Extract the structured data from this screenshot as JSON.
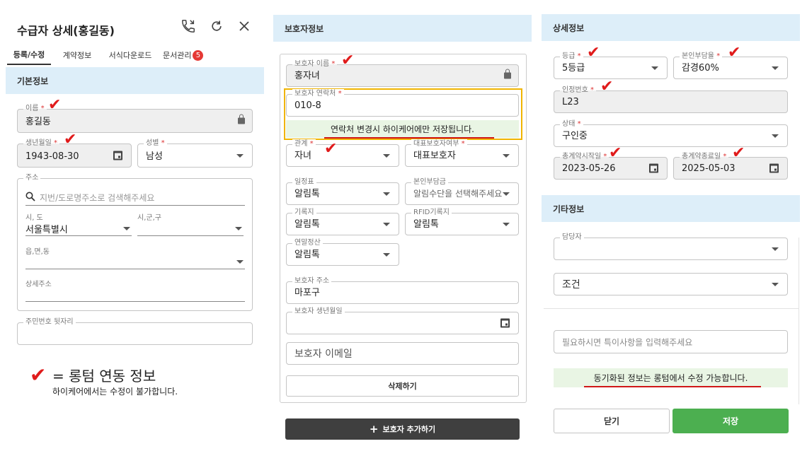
{
  "left": {
    "title": "수급자 상세(홍길동)",
    "tabs": [
      "등록/수정",
      "계약정보",
      "서식다운로드",
      "문서관리"
    ],
    "doc_badge": "5",
    "section": "기본정보",
    "name": {
      "label": "이름",
      "value": "홍길동"
    },
    "birth": {
      "label": "생년월일",
      "value": "1943-08-30"
    },
    "gender": {
      "label": "성별",
      "value": "남성"
    },
    "address": {
      "label": "주소",
      "search_placeholder": "지번/도로명주소로 검색해주세요",
      "sido_label": "시, 도",
      "sido_value": "서울특별시",
      "sigungu_label": "시,군,구",
      "dong_label": "읍,면,동",
      "detail_label": "상세주소"
    },
    "rrn": {
      "label": "주민번호 뒷자리"
    },
    "legend_title": "= 롱텀 연동 정보",
    "legend_sub": "하이케어에서는 수정이 불가합니다."
  },
  "middle": {
    "section": "보호자정보",
    "guardian_name": {
      "label": "보호자 이름",
      "value": "홍자녀"
    },
    "guardian_phone": {
      "label": "보호자 연락처",
      "value": "010-8"
    },
    "phone_notice": "연락처 변경시 하이케어에만 저장됩니다.",
    "relation": {
      "label": "관계",
      "value": "자녀"
    },
    "primary": {
      "label": "대표보호자여부",
      "value": "대표보호자"
    },
    "schedule": {
      "label": "일정표",
      "value": "알림톡"
    },
    "copay": {
      "label": "본인부담금",
      "value": "알림수단을 선택해주세요"
    },
    "record": {
      "label": "기록지",
      "value": "알림톡"
    },
    "rfid": {
      "label": "RFID기록지",
      "value": "알림톡"
    },
    "yearend": {
      "label": "연말정산",
      "value": "알림톡"
    },
    "guardian_addr": {
      "label": "보호자 주소",
      "value": "마포구"
    },
    "guardian_birth": {
      "label": "보호자 생년월일"
    },
    "guardian_email": {
      "placeholder": "보호자 이메일"
    },
    "delete_label": "삭제하기",
    "add_label": "보호자 추가하기"
  },
  "right": {
    "section": "상세정보",
    "grade": {
      "label": "등급",
      "value": "5등급"
    },
    "copay_rate": {
      "label": "본인부담율",
      "value": "감경60%"
    },
    "cert_no": {
      "label": "인정번호",
      "value": "L23"
    },
    "status": {
      "label": "상태",
      "value": "구인중"
    },
    "contract_start": {
      "label": "총계약시작일",
      "value": "2023-05-26"
    },
    "contract_end": {
      "label": "총계약종료일",
      "value": "2025-05-03"
    },
    "etc_section": "기타정보",
    "manager": {
      "label": "담당자"
    },
    "condition": {
      "value": "조건"
    },
    "memo_placeholder": "필요하시면 특이사항을 입력해주세요",
    "sync_notice": "동기화된 정보는 롱텀에서 수정 가능합니다.",
    "close_label": "닫기",
    "save_label": "저장"
  },
  "check_glyph": "✔",
  "colors": {
    "accent_green": "#4caf50",
    "header_blue": "#ddeef9",
    "check_red": "#e01b1b",
    "badge_red": "#e53935",
    "highlight_orange": "#f0b400"
  }
}
